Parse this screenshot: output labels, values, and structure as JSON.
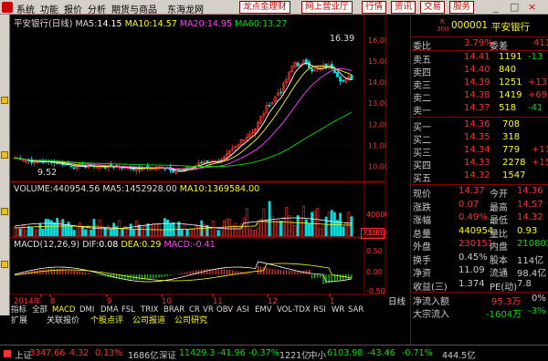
{
  "menu": {
    "items": [
      "系统",
      "功能",
      "报价",
      "分析",
      "期货与商品",
      "东海龙网"
    ],
    "buttons": [
      "龙点金理财",
      "网上营业厅",
      "行情",
      "资讯",
      "交易",
      "服务"
    ],
    "window_controls": [
      "_",
      "□",
      "×"
    ]
  },
  "chart_header": {
    "stock": "平安银行(日线)",
    "ma5_label": "MA5:",
    "ma5": "14.15",
    "ma10_label": "MA10:",
    "ma10": "14.57",
    "ma20_label": "MA20:",
    "ma20": "14.95",
    "ma60_label": "MA60:",
    "ma60": "13.27",
    "high_mark": "16.39",
    "low_mark": "9.52",
    "price_ticks": [
      "16.00",
      "15.00",
      "14.00",
      "13.00",
      "12.00",
      "11.00",
      "10.00"
    ]
  },
  "volume_header": {
    "label": "VOLUME:",
    "value": "440954.56",
    "ma5_label": "MA5:",
    "ma5": "1452928.00",
    "ma10_label": "MA10:",
    "ma10": "1369584.00",
    "ticks": [
      "40000",
      "20000"
    ],
    "unit": "X100"
  },
  "macd_header": {
    "label": "MACD(12,26,9)",
    "dif_label": "DIF:",
    "dif": "0.08",
    "dea_label": "DEA:",
    "dea": "0.29",
    "macd_label": "MACD:",
    "macd": "-0.41",
    "ticks": [
      "0.50",
      "0.00",
      "-0.50"
    ]
  },
  "time_axis": {
    "labels": [
      "2014年",
      "8",
      "9",
      "10",
      "11",
      "12",
      "1"
    ],
    "period": "日线"
  },
  "indicator_tabs": [
    "指标",
    "全部",
    "MACD",
    "DMI",
    "DMA",
    "FSL",
    "TRIX",
    "BRAR",
    "CR",
    "VR",
    "OBV",
    "ASI",
    "EMV",
    "VOL-TDX",
    "RSI",
    "WR",
    "SAR"
  ],
  "bottom_tabs": [
    "扩展",
    "关联报价",
    "个股点评",
    "公司报道",
    "公司研究"
  ],
  "quote": {
    "code": "000001",
    "name": "平安银行",
    "r_label": "R",
    "r_code": "300",
    "weibi_label": "委比",
    "weibi": "3.79%",
    "weicha_label": "委差",
    "weicha": "411",
    "sell": [
      {
        "label": "卖五",
        "price": "14.41",
        "vol": "1191",
        "chg": "-13"
      },
      {
        "label": "卖四",
        "price": "14.40",
        "vol": "840",
        "chg": ""
      },
      {
        "label": "卖三",
        "price": "14.39",
        "vol": "1251",
        "chg": "+13"
      },
      {
        "label": "卖二",
        "price": "14.38",
        "vol": "1419",
        "chg": "+690"
      },
      {
        "label": "卖一",
        "price": "14.37",
        "vol": "518",
        "chg": "-41"
      }
    ],
    "buy": [
      {
        "label": "买一",
        "price": "14.36",
        "vol": "708",
        "chg": ""
      },
      {
        "label": "买二",
        "price": "14.35",
        "vol": "318",
        "chg": ""
      },
      {
        "label": "买三",
        "price": "14.34",
        "vol": "779",
        "chg": "+11"
      },
      {
        "label": "买四",
        "price": "14.33",
        "vol": "2278",
        "chg": "+15"
      },
      {
        "label": "买五",
        "price": "14.32",
        "vol": "1547",
        "chg": ""
      }
    ],
    "stats": [
      {
        "l1": "现价",
        "v1": "14.37",
        "l2": "今开",
        "v2": "14.36"
      },
      {
        "l1": "涨跌",
        "v1": "0.07",
        "l2": "最高",
        "v2": "14.57"
      },
      {
        "l1": "涨幅",
        "v1": "0.49%",
        "l2": "最低",
        "v2": "14.32"
      },
      {
        "l1": "总量",
        "v1": "440954",
        "l2": "量比",
        "v2": "0.93"
      },
      {
        "l1": "外盘",
        "v1": "230151",
        "l2": "内盘",
        "v2": "210803"
      },
      {
        "l1": "换手",
        "v1": "0.45%",
        "l2": "股本",
        "v2": "114亿"
      },
      {
        "l1": "净资",
        "v1": "11.09",
        "l2": "流通",
        "v2": "98.4亿"
      },
      {
        "l1": "收益(三)",
        "v1": "1.374",
        "l2": "PE(动)",
        "v2": "7.8"
      }
    ],
    "inflow_label": "净流入额",
    "inflow": "95.3万",
    "inflow_pct": "0%",
    "big_label": "大宗流入",
    "big": "-1604万",
    "big_pct": "-3%"
  },
  "status": {
    "sh_label": "上证",
    "sh": "3347.66",
    "sh_chg": "4.32",
    "sh_pct": "0.13%",
    "sh_amt": "1686亿",
    "sz_label": "深证",
    "sz": "11429.3",
    "sz_chg": "-41.96",
    "sz_pct": "-0.37%",
    "sz_amt": "1221亿",
    "zx_label": "中小",
    "zx": "6103.98",
    "zx_chg": "-43.46",
    "zx_pct": "-0.71%",
    "zx_amt": "444.5亿"
  },
  "colors": {
    "up": "#ff3030",
    "down": "#00e000",
    "flat": "#ffffff",
    "label": "#c0c0c0",
    "yellow": "#ffff00",
    "magenta": "#ff40ff",
    "cyan": "#00c0c0"
  }
}
